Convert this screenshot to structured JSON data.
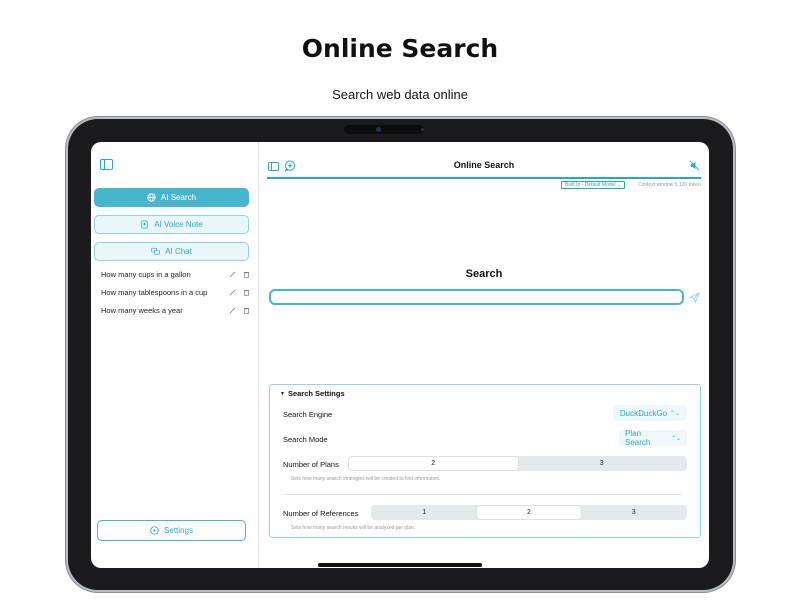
{
  "hero": {
    "title": "Online Search",
    "subtitle": "Search web data online"
  },
  "sidebar": {
    "nav": [
      {
        "label": "AI Search",
        "icon": "globe-icon",
        "active": true
      },
      {
        "label": "AI Voice Note",
        "icon": "voice-note-icon",
        "active": false
      },
      {
        "label": "AI Chat",
        "icon": "chat-bubbles-icon",
        "active": false
      }
    ],
    "history": [
      {
        "text": "How many cups in a gallon"
      },
      {
        "text": "How many tablespoons in a cup"
      },
      {
        "text": "How many weeks a year"
      }
    ],
    "settings_label": "Settings"
  },
  "main": {
    "title": "Online Search",
    "model_badge": "Built In - Default Model ⌄",
    "context": "Context window 5,120 token",
    "search_heading": "Search",
    "search_value": "",
    "search_placeholder": ""
  },
  "settings_panel": {
    "title": "Search Settings",
    "engine_label": "Search Engine",
    "engine_value": "DuckDuckGo",
    "mode_label": "Search Mode",
    "mode_value": "Plan Search",
    "plans_label": "Number of Plans",
    "plans_options": [
      "2",
      "3"
    ],
    "plans_selected": "2",
    "plans_help": "Sets how many search strategies will be created to find information.",
    "refs_label": "Number of References",
    "refs_options": [
      "1",
      "2",
      "3"
    ],
    "refs_selected": "2",
    "refs_help": "Sets how many search results will be analyzed per plan."
  },
  "colors": {
    "accent": "#47b6cc",
    "accent_text": "#2aa7bf",
    "accent_light": "#e9f7fa"
  }
}
